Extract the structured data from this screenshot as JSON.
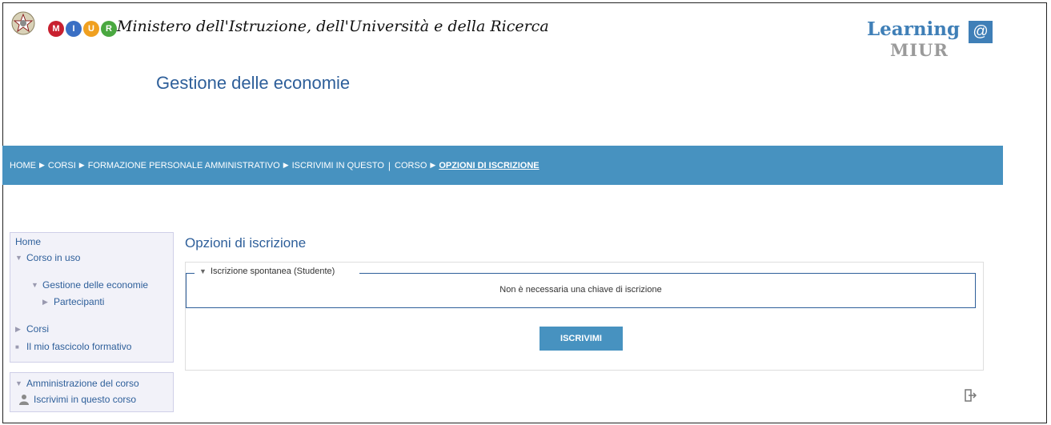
{
  "header": {
    "ministry_name": "Ministero dell'Istruzione, dell'Università e della Ricerca",
    "miur_letters": [
      "M",
      "I",
      "U",
      "R"
    ],
    "miur_colors": [
      "#c8202f",
      "#3a6fc4",
      "#f0a020",
      "#4aa840"
    ],
    "learning_logo": {
      "word": "Learning",
      "at": "@",
      "sub": "MIUR"
    },
    "course_title": "Gestione delle economie"
  },
  "breadcrumb": {
    "items": [
      {
        "label": "HOME"
      },
      {
        "label": "CORSI"
      },
      {
        "label": "FORMAZIONE PERSONALE AMMINISTRATIVO"
      },
      {
        "label": "ISCRIVIMI IN QUESTO"
      },
      {
        "label": "CORSO"
      },
      {
        "label": "OPZIONI DI ISCRIZIONE"
      }
    ],
    "bg_color": "#4792c0"
  },
  "sidebar": {
    "navigation": {
      "home": "Home",
      "current_course": "Corso in uso",
      "course_name": "Gestione delle economie",
      "participants": "Partecipanti",
      "courses": "Corsi",
      "training_file": "Il mio fascicolo formativo"
    },
    "administration": {
      "title": "Amministrazione del corso",
      "enrol_link": "Iscrivimi in questo corso"
    }
  },
  "main": {
    "title": "Opzioni di iscrizione",
    "enrolment_section": {
      "legend": "Iscrizione spontanea (Studente)",
      "message": "Non è necessaria una chiave di iscrizione"
    },
    "enrol_button": "ISCRIVIMI"
  },
  "icons": {
    "collapsed": "triangle-right",
    "expanded": "triangle-down",
    "logout": "logout-icon"
  }
}
